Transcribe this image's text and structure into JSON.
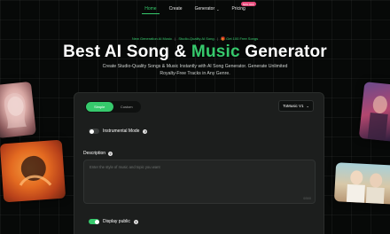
{
  "nav": {
    "items": [
      {
        "label": "Home",
        "active": true
      },
      {
        "label": "Create"
      },
      {
        "label": "Generator"
      },
      {
        "label": "Pricing",
        "badge": "50% OFF"
      }
    ]
  },
  "announcement": {
    "part1": "New Generation AI Music",
    "part2": "Studio-Quality AI Song",
    "gift_icon": "gift-icon",
    "part3": "Get 100 Free Songs"
  },
  "hero": {
    "title_part1": "Best AI Song & ",
    "title_accent": "Music",
    "title_part2": " Generator",
    "subtitle": "Create Studio-Quality Songs & Music Instantly with AI Song Generator. Generate Unlimited Royalty-Free Tracks in Any Genre."
  },
  "form": {
    "tabs": [
      {
        "label": "Simple",
        "active": true
      },
      {
        "label": "Custom"
      }
    ],
    "model": "ToMusic V1",
    "instrumental_label": "Instrumental Mode",
    "instrumental_on": false,
    "description_label": "Description",
    "description_placeholder": "Enter the style of music and topic you want",
    "char_counter": "0/500",
    "display_public_label": "Display public",
    "display_public_on": true
  },
  "colors": {
    "accent": "#36c96c",
    "background": "#070908",
    "card": "#1c1e1d",
    "badge": "#e64a7a"
  }
}
